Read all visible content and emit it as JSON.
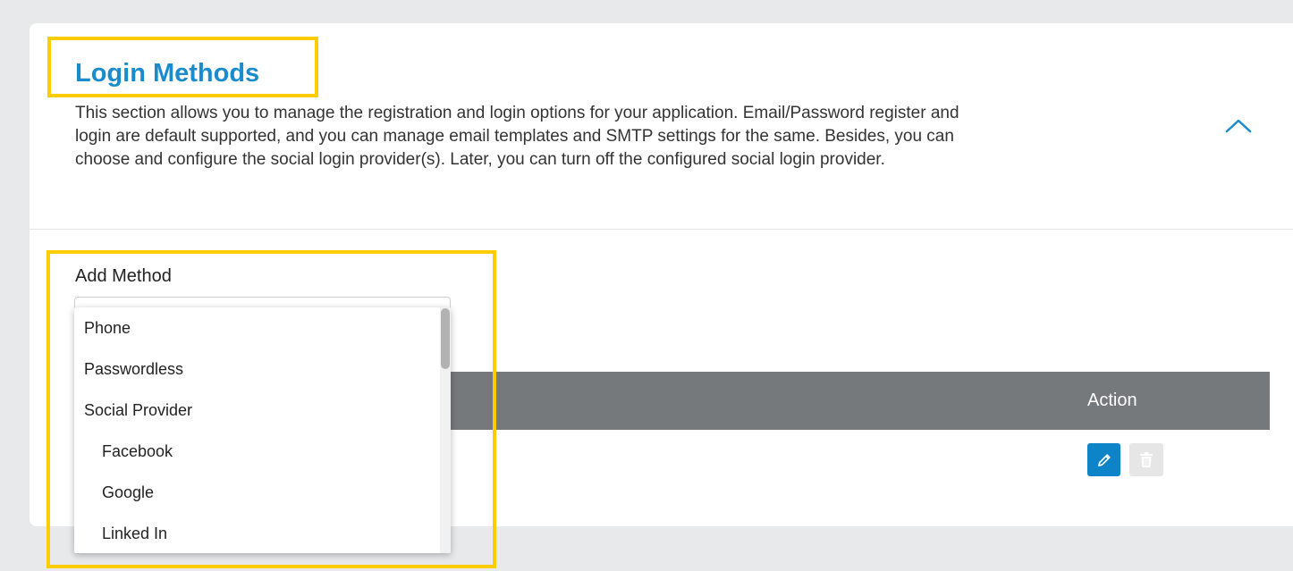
{
  "header": {
    "title": "Login Methods",
    "description": "This section allows you to manage the registration and login options for your application. Email/Password register and login are default supported, and you can manage email templates and SMTP settings for the same. Besides, you can choose and configure the social login provider(s). Later, you can turn off the configured social login provider.",
    "collapse_icon": "chevron-up-icon"
  },
  "add_method": {
    "label": "Add Method",
    "selected_value": "",
    "options": [
      {
        "label": "Phone",
        "indent": false
      },
      {
        "label": "Passwordless",
        "indent": false
      },
      {
        "label": "Social Provider",
        "indent": false
      },
      {
        "label": "Facebook",
        "indent": true
      },
      {
        "label": "Google",
        "indent": true
      },
      {
        "label": "Linked In",
        "indent": true
      }
    ]
  },
  "table": {
    "action_header": "Action",
    "row_actions": {
      "edit_icon": "pencil-icon",
      "delete_icon": "trash-icon"
    }
  },
  "colors": {
    "accent": "#1a8ccd",
    "highlight": "#ffcc00",
    "table_header": "#76797c",
    "edit_button": "#0d84c8"
  }
}
